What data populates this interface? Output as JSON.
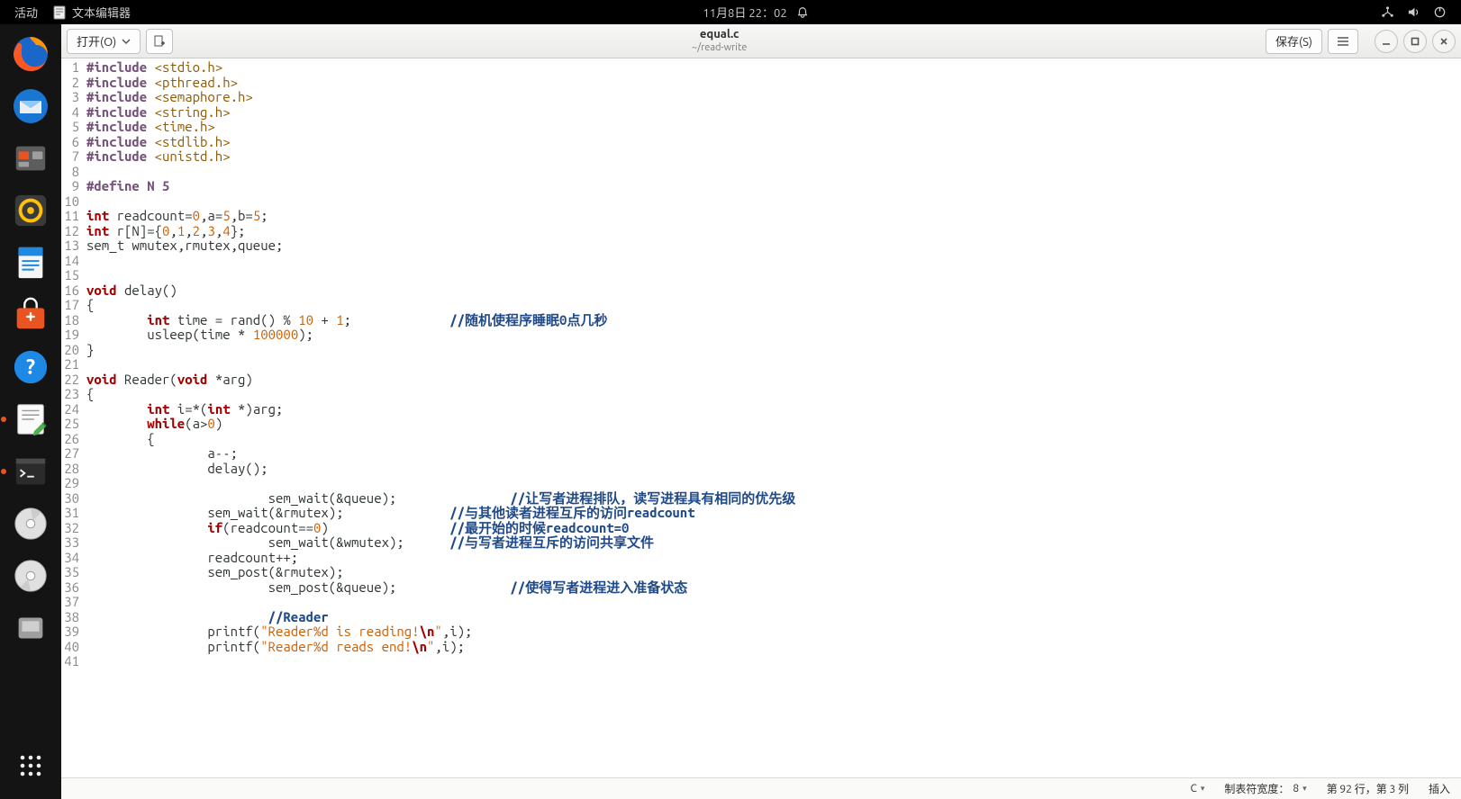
{
  "panel": {
    "activities": "活动",
    "app_label": "文本编辑器",
    "clock": "11月8日 22：02"
  },
  "dock": {
    "items": [
      {
        "name": "firefox"
      },
      {
        "name": "thunderbird"
      },
      {
        "name": "files"
      },
      {
        "name": "rhythmbox"
      },
      {
        "name": "libreoffice-writer"
      },
      {
        "name": "software"
      },
      {
        "name": "help"
      },
      {
        "name": "text-editor"
      },
      {
        "name": "terminal"
      },
      {
        "name": "disc1"
      },
      {
        "name": "disc2"
      },
      {
        "name": "removable"
      }
    ]
  },
  "header": {
    "open_label": "打开(O)",
    "save_label": "保存(S)",
    "filename": "equal.c",
    "filepath": "~/read-write"
  },
  "status": {
    "lang": "C",
    "tabwidth_label": "制表符宽度：",
    "tabwidth_value": "8",
    "lncol": "第 92 行，第 3 列",
    "mode": "插入"
  },
  "code": {
    "lines": [
      {
        "n": 1,
        "seg": [
          [
            "pp",
            "#include "
          ],
          [
            "inc",
            "<stdio.h>"
          ]
        ]
      },
      {
        "n": 2,
        "seg": [
          [
            "pp",
            "#include "
          ],
          [
            "inc",
            "<pthread.h>"
          ]
        ]
      },
      {
        "n": 3,
        "seg": [
          [
            "pp",
            "#include "
          ],
          [
            "inc",
            "<semaphore.h>"
          ]
        ]
      },
      {
        "n": 4,
        "seg": [
          [
            "pp",
            "#include "
          ],
          [
            "inc",
            "<string.h>"
          ]
        ]
      },
      {
        "n": 5,
        "seg": [
          [
            "pp",
            "#include "
          ],
          [
            "inc",
            "<time.h>"
          ]
        ]
      },
      {
        "n": 6,
        "seg": [
          [
            "pp",
            "#include "
          ],
          [
            "inc",
            "<stdlib.h>"
          ]
        ]
      },
      {
        "n": 7,
        "seg": [
          [
            "pp",
            "#include "
          ],
          [
            "inc",
            "<unistd.h>"
          ]
        ]
      },
      {
        "n": 8,
        "seg": []
      },
      {
        "n": 9,
        "seg": [
          [
            "pp",
            "#define N 5"
          ]
        ]
      },
      {
        "n": 10,
        "seg": []
      },
      {
        "n": 11,
        "seg": [
          [
            "type",
            "int"
          ],
          [
            "",
            " readcount="
          ],
          [
            "num",
            "0"
          ],
          [
            "",
            ",a="
          ],
          [
            "num",
            "5"
          ],
          [
            "",
            ",b="
          ],
          [
            "num",
            "5"
          ],
          [
            "",
            ";"
          ]
        ]
      },
      {
        "n": 12,
        "seg": [
          [
            "type",
            "int"
          ],
          [
            "",
            " r[N]={"
          ],
          [
            "num",
            "0"
          ],
          [
            "",
            ","
          ],
          [
            "num",
            "1"
          ],
          [
            "",
            ","
          ],
          [
            "num",
            "2"
          ],
          [
            "",
            ","
          ],
          [
            "num",
            "3"
          ],
          [
            "",
            ","
          ],
          [
            "num",
            "4"
          ],
          [
            "",
            "};"
          ]
        ]
      },
      {
        "n": 13,
        "seg": [
          [
            "",
            "sem_t wmutex,rmutex,queue;"
          ]
        ]
      },
      {
        "n": 14,
        "seg": []
      },
      {
        "n": 15,
        "seg": []
      },
      {
        "n": 16,
        "seg": [
          [
            "type",
            "void"
          ],
          [
            "",
            " delay()"
          ]
        ]
      },
      {
        "n": 17,
        "seg": [
          [
            "",
            "{"
          ]
        ]
      },
      {
        "n": 18,
        "seg": [
          [
            "",
            "        "
          ],
          [
            "type",
            "int"
          ],
          [
            "",
            " time = rand() % "
          ],
          [
            "num",
            "10"
          ],
          [
            "",
            " + "
          ],
          [
            "num",
            "1"
          ],
          [
            "",
            ";             "
          ],
          [
            "cmt",
            "//随机使程序睡眠0点几秒"
          ]
        ]
      },
      {
        "n": 19,
        "seg": [
          [
            "",
            "        usleep(time * "
          ],
          [
            "num",
            "100000"
          ],
          [
            "",
            ");"
          ]
        ]
      },
      {
        "n": 20,
        "seg": [
          [
            "",
            "}"
          ]
        ]
      },
      {
        "n": 21,
        "seg": []
      },
      {
        "n": 22,
        "seg": [
          [
            "type",
            "void"
          ],
          [
            "",
            " Reader("
          ],
          [
            "type",
            "void"
          ],
          [
            "",
            " *arg)"
          ]
        ]
      },
      {
        "n": 23,
        "seg": [
          [
            "",
            "{"
          ]
        ]
      },
      {
        "n": 24,
        "seg": [
          [
            "",
            "        "
          ],
          [
            "type",
            "int"
          ],
          [
            "",
            " i=*("
          ],
          [
            "type",
            "int"
          ],
          [
            "",
            " *)arg;"
          ]
        ]
      },
      {
        "n": 25,
        "seg": [
          [
            "",
            "        "
          ],
          [
            "kw",
            "while"
          ],
          [
            "",
            "(a>"
          ],
          [
            "num",
            "0"
          ],
          [
            "",
            ")"
          ]
        ]
      },
      {
        "n": 26,
        "seg": [
          [
            "",
            "        {"
          ]
        ]
      },
      {
        "n": 27,
        "seg": [
          [
            "",
            "                a--;"
          ]
        ]
      },
      {
        "n": 28,
        "seg": [
          [
            "",
            "                delay();"
          ]
        ]
      },
      {
        "n": 29,
        "seg": []
      },
      {
        "n": 30,
        "seg": [
          [
            "",
            "                        sem_wait(&queue);               "
          ],
          [
            "cmt",
            "//让写者进程排队，读写进程具有相同的优先级"
          ]
        ]
      },
      {
        "n": 31,
        "seg": [
          [
            "",
            "                sem_wait(&rmutex);              "
          ],
          [
            "cmt",
            "//与其他读者进程互斥的访问readcount"
          ]
        ]
      },
      {
        "n": 32,
        "seg": [
          [
            "",
            "                "
          ],
          [
            "kw",
            "if"
          ],
          [
            "",
            "(readcount=="
          ],
          [
            "num",
            "0"
          ],
          [
            "",
            ")                "
          ],
          [
            "cmt",
            "//最开始的时候readcount=0"
          ]
        ]
      },
      {
        "n": 33,
        "seg": [
          [
            "",
            "                        sem_wait(&wmutex);      "
          ],
          [
            "cmt",
            "//与写者进程互斥的访问共享文件"
          ]
        ]
      },
      {
        "n": 34,
        "seg": [
          [
            "",
            "                readcount++;"
          ]
        ]
      },
      {
        "n": 35,
        "seg": [
          [
            "",
            "                sem_post(&rmutex);"
          ]
        ]
      },
      {
        "n": 36,
        "seg": [
          [
            "",
            "                        sem_post(&queue);               "
          ],
          [
            "cmt",
            "//使得写者进程进入准备状态"
          ]
        ]
      },
      {
        "n": 37,
        "seg": []
      },
      {
        "n": 38,
        "seg": [
          [
            "",
            "                        "
          ],
          [
            "cmt",
            "//Reader"
          ]
        ]
      },
      {
        "n": 39,
        "seg": [
          [
            "",
            "                printf("
          ],
          [
            "str",
            "\"Reader%d is reading!"
          ],
          [
            "esc",
            "\\n"
          ],
          [
            "str",
            "\""
          ],
          [
            "",
            ",i);"
          ]
        ]
      },
      {
        "n": 40,
        "seg": [
          [
            "",
            "                printf("
          ],
          [
            "str",
            "\"Reader%d reads end!"
          ],
          [
            "esc",
            "\\n"
          ],
          [
            "str",
            "\""
          ],
          [
            "",
            ",i);"
          ]
        ]
      },
      {
        "n": 41,
        "seg": []
      }
    ]
  }
}
